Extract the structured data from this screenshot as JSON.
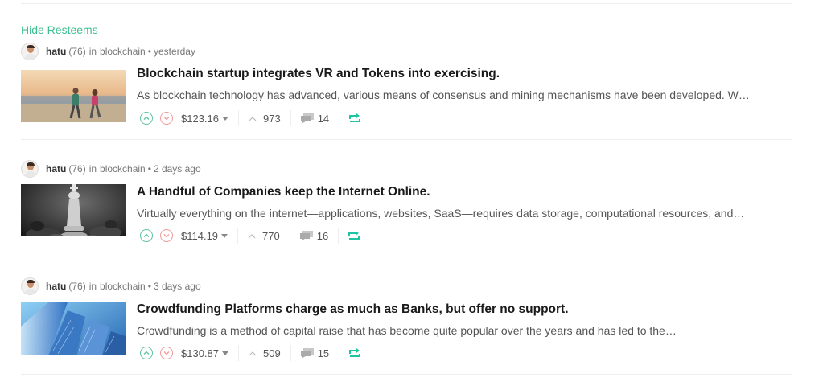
{
  "hide_resteems_label": "Hide Resteems",
  "colors": {
    "accent": "#3cbf8f",
    "upvote": "#5bc3a3",
    "downvote": "#f19a9a"
  },
  "posts": [
    {
      "author": "hatu",
      "reputation": "(76)",
      "in_word": "in",
      "category": "blockchain",
      "separator": "•",
      "time": "yesterday",
      "title": "Blockchain startup integrates VR and Tokens into exercising.",
      "summary": "As blockchain technology has advanced, various means of consensus and mining mechanisms have been developed. W…",
      "payout": "$123.16",
      "votes": "973",
      "comments": "14",
      "thumbnail": "beach-runners-image"
    },
    {
      "author": "hatu",
      "reputation": "(76)",
      "in_word": "in",
      "category": "blockchain",
      "separator": "•",
      "time": "2 days ago",
      "title": "A Handful of Companies keep the Internet Online.",
      "summary": "Virtually everything on the internet—applications, websites, SaaS—requires data storage, computational resources, and…",
      "payout": "$114.19",
      "votes": "770",
      "comments": "16",
      "thumbnail": "chess-king-image"
    },
    {
      "author": "hatu",
      "reputation": "(76)",
      "in_word": "in",
      "category": "blockchain",
      "separator": "•",
      "time": "3 days ago",
      "title": "Crowdfunding Platforms charge as much as Banks, but offer no support.",
      "summary": "Crowdfunding is a method of capital raise that has become quite popular over the years and has led to the…",
      "payout": "$130.87",
      "votes": "509",
      "comments": "15",
      "thumbnail": "skyscrapers-image"
    }
  ]
}
